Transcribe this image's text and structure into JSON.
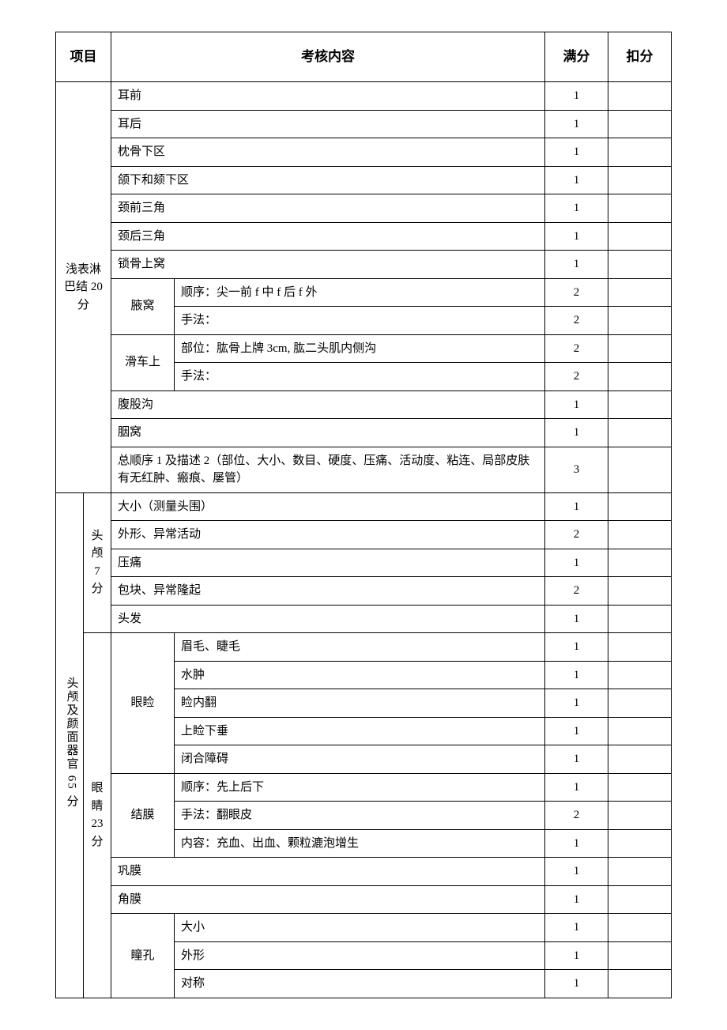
{
  "headers": {
    "project": "项目",
    "content": "考核内容",
    "full_score": "满分",
    "deduct": "扣分"
  },
  "sections": {
    "lymph": {
      "label": "浅表淋巴结 20 分",
      "rows": {
        "r0": {
          "content": "耳前",
          "score": "1"
        },
        "r1": {
          "content": "耳后",
          "score": "1"
        },
        "r2": {
          "content": "枕骨下区",
          "score": "1"
        },
        "r3": {
          "content": "颌下和颏下区",
          "score": "1"
        },
        "r4": {
          "content": "颈前三角",
          "score": "1"
        },
        "r5": {
          "content": "颈后三角",
          "score": "1"
        },
        "r6": {
          "content": "锁骨上窝",
          "score": "1"
        },
        "r7": {
          "sub": "腋窝",
          "content": "顺序：尖一前 f 中 f 后 f 外",
          "score": "2"
        },
        "r8": {
          "content": "手法：",
          "score": "2"
        },
        "r9": {
          "sub": "滑车上",
          "content": "部位：肱骨上牌 3cm, 肱二头肌内侧沟",
          "score": "2"
        },
        "r10": {
          "content": "手法：",
          "score": "2"
        },
        "r11": {
          "content": "腹股沟",
          "score": "1"
        },
        "r12": {
          "content": "胭窝",
          "score": "1"
        },
        "r13": {
          "content": "总顺序 1 及描述 2（部位、大小、数目、硬度、压痛、活动度、粘连、局部皮肤有无红肿、瘢痕、屡管）",
          "score": "3"
        }
      }
    },
    "headface": {
      "label": "头颅及颜面器官 65 分",
      "sub_skull": {
        "label": "头颅7 分",
        "rows": {
          "r0": {
            "content": "大小（测量头围）",
            "score": "1"
          },
          "r1": {
            "content": "外形、异常活动",
            "score": "2"
          },
          "r2": {
            "content": "压痛",
            "score": "1"
          },
          "r3": {
            "content": "包块、异常隆起",
            "score": "2"
          },
          "r4": {
            "content": "头发",
            "score": "1"
          }
        }
      },
      "sub_eye": {
        "label": "眼睛 23 分",
        "eyelid": {
          "label": "眼睑",
          "rows": {
            "r0": {
              "content": "眉毛、睫毛",
              "score": "1"
            },
            "r1": {
              "content": "水肿",
              "score": "1"
            },
            "r2": {
              "content": "睑内翻",
              "score": "1"
            },
            "r3": {
              "content": "上睑下垂",
              "score": "1"
            },
            "r4": {
              "content": "闭合障碍",
              "score": "1"
            }
          }
        },
        "conjunctiva": {
          "label": "结膜",
          "rows": {
            "r0": {
              "content": "顺序：先上后下",
              "score": "1"
            },
            "r1": {
              "content": "手法：翻眼皮",
              "score": "2"
            },
            "r2": {
              "content": "内容：充血、出血、颗粒漉泡增生",
              "score": "1"
            }
          }
        },
        "sclera": {
          "content": "巩膜",
          "score": "1"
        },
        "cornea": {
          "content": "角膜",
          "score": "1"
        },
        "pupil": {
          "label": "瞳孔",
          "rows": {
            "r0": {
              "content": "大小",
              "score": "1"
            },
            "r1": {
              "content": "外形",
              "score": "1"
            },
            "r2": {
              "content": "对称",
              "score": "1"
            }
          }
        }
      }
    }
  }
}
